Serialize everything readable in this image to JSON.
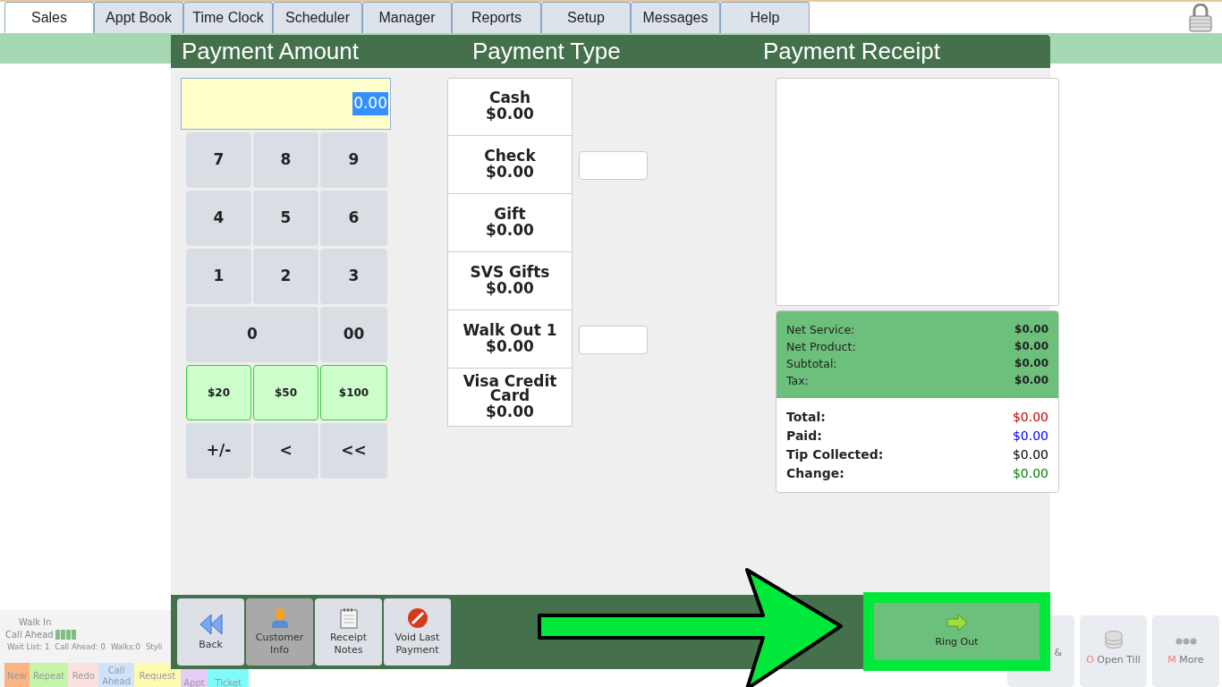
{
  "tabs": [
    {
      "label": "Sales",
      "selected": true
    },
    {
      "label": "Appt Book",
      "selected": false
    },
    {
      "label": "Time Clock",
      "selected": false
    },
    {
      "label": "Scheduler",
      "selected": false
    },
    {
      "label": "Manager",
      "selected": false
    },
    {
      "label": "Reports",
      "selected": false
    },
    {
      "label": "Setup",
      "selected": false
    },
    {
      "label": "Messages",
      "selected": false
    },
    {
      "label": "Help",
      "selected": false
    }
  ],
  "queue_panel": {
    "walk_in": "Walk In",
    "call_ahead": "Call Ahead",
    "stats": [
      "Wait List: 1",
      "Call Ahead: 0",
      "Walks:0",
      "Styli"
    ],
    "ticket_buttons": [
      {
        "label": "New",
        "color": "#fbb482"
      },
      {
        "label": "Repeat",
        "color": "#c4f5a8"
      },
      {
        "label": "Redo",
        "color": "#fde0e0"
      },
      {
        "label": "Call Ahead",
        "color": "#cfe4fb"
      },
      {
        "label": "Request",
        "color": "#fdfbb0"
      },
      {
        "label": "Appt",
        "color": "#e5cdf8"
      },
      {
        "label": "Ticket",
        "color": "#80fbfb"
      }
    ]
  },
  "bottom_buttons": [
    {
      "label": "&"
    },
    {
      "hotkey": "O",
      "label": "Open Till"
    },
    {
      "hotkey": "M",
      "label": "More"
    }
  ],
  "payment": {
    "headers": [
      "Payment Amount",
      "Payment Type",
      "Payment Receipt"
    ],
    "amount": {
      "value": "0.00"
    },
    "keys": [
      {
        "label": "7",
        "kind": "digit"
      },
      {
        "label": "8",
        "kind": "digit"
      },
      {
        "label": "9",
        "kind": "digit"
      },
      {
        "label": "4",
        "kind": "digit"
      },
      {
        "label": "5",
        "kind": "digit"
      },
      {
        "label": "6",
        "kind": "digit"
      },
      {
        "label": "1",
        "kind": "digit"
      },
      {
        "label": "2",
        "kind": "digit"
      },
      {
        "label": "3",
        "kind": "digit"
      },
      {
        "label": "0",
        "kind": "wide"
      },
      {
        "label": "00",
        "kind": "digit"
      },
      {
        "label": "$20",
        "kind": "cash"
      },
      {
        "label": "$50",
        "kind": "cash"
      },
      {
        "label": "$100",
        "kind": "cash"
      },
      {
        "label": "+/-",
        "kind": "digit"
      },
      {
        "label": "<",
        "kind": "digit"
      },
      {
        "label": "<<",
        "kind": "digit"
      }
    ],
    "types": [
      {
        "name": "Cash",
        "amount": "$0.00",
        "field": false
      },
      {
        "name": "Check",
        "amount": "$0.00",
        "field": true
      },
      {
        "name": "Gift",
        "amount": "$0.00",
        "field": false
      },
      {
        "name": "SVS Gifts",
        "amount": "$0.00",
        "field": false
      },
      {
        "name": "Walk Out 1",
        "amount": "$0.00",
        "field": true
      },
      {
        "name": "Visa Credit Card",
        "amount": "$0.00",
        "field": false
      }
    ],
    "summary": [
      {
        "label": "Net Service:",
        "value": "$0.00"
      },
      {
        "label": "Net Product:",
        "value": "$0.00"
      },
      {
        "label": "Subtotal:",
        "value": "$0.00"
      },
      {
        "label": "Tax:",
        "value": "$0.00"
      }
    ],
    "totals": [
      {
        "label": "Total:",
        "value": "$0.00",
        "color": "#c00000"
      },
      {
        "label": "Paid:",
        "value": "$0.00",
        "color": "#0000ff"
      },
      {
        "label": "Tip Collected:",
        "value": "$0.00",
        "color": "#000000"
      },
      {
        "label": "Change:",
        "value": "$0.00",
        "color": "#008000"
      }
    ],
    "actions": [
      {
        "label": "Back",
        "selected": false
      },
      {
        "label": "Customer Info",
        "selected": true
      },
      {
        "label": "Receipt Notes",
        "selected": false
      },
      {
        "label": "Void Last Payment",
        "selected": false
      }
    ],
    "ring_out": "Ring Out"
  }
}
